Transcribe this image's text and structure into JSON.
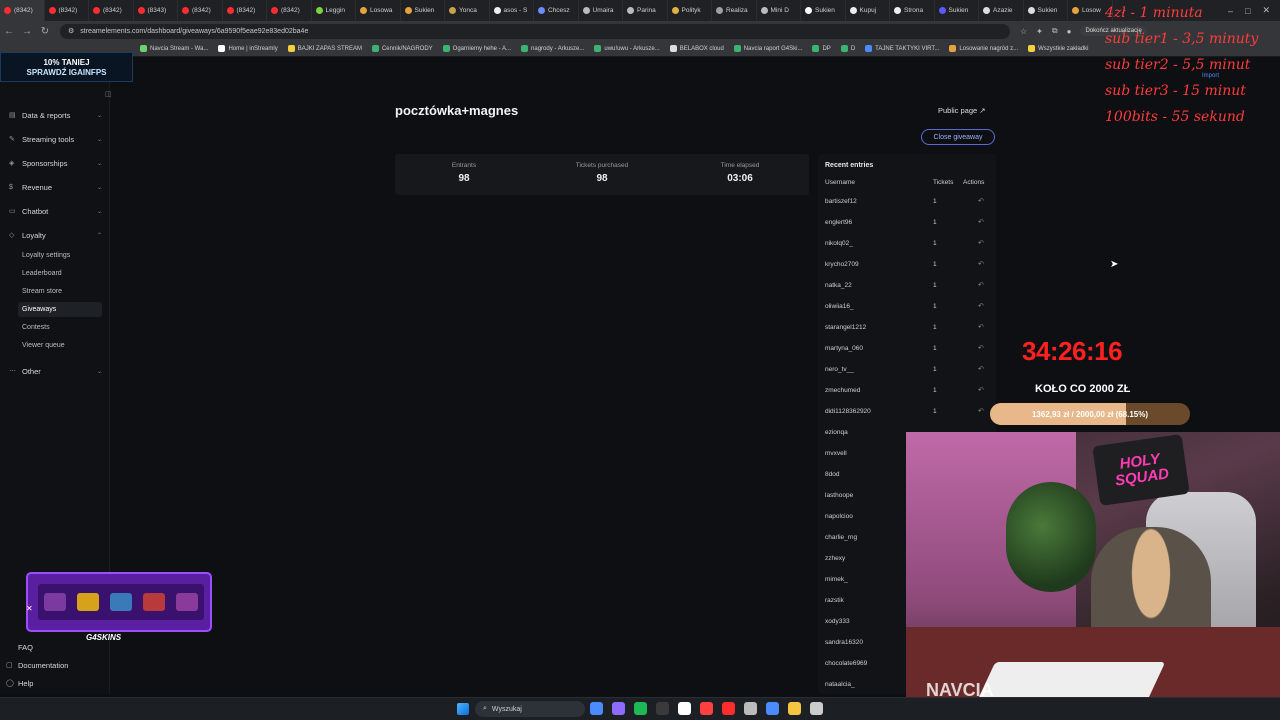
{
  "browser": {
    "tabs": [
      {
        "label": "(8342)",
        "color": "#ff2d2d"
      },
      {
        "label": "(8342)",
        "color": "#ff2d2d"
      },
      {
        "label": "(8342)",
        "color": "#ff2d2d"
      },
      {
        "label": "(8343)",
        "color": "#ff2d2d"
      },
      {
        "label": "(8342)",
        "color": "#ff2d2d"
      },
      {
        "label": "(8342)",
        "color": "#ff2d2d"
      },
      {
        "label": "(8342)",
        "color": "#ff2d2d"
      },
      {
        "label": "Leggin",
        "color": "#7cd142"
      },
      {
        "label": "Losowa",
        "color": "#e6a23c"
      },
      {
        "label": "Sukien",
        "color": "#e6a23c"
      },
      {
        "label": "Yonca",
        "color": "#c8a14b"
      },
      {
        "label": "asos - S",
        "color": "#eeeeee"
      },
      {
        "label": "Chcesz",
        "color": "#6b8cff"
      },
      {
        "label": "Umaira",
        "color": "#bbbbbb"
      },
      {
        "label": "Parina",
        "color": "#bbbbbb"
      },
      {
        "label": "Polityk",
        "color": "#e0b040"
      },
      {
        "label": "Realiza",
        "color": "#9aa0a6"
      },
      {
        "label": "Mini D",
        "color": "#bbbbbb"
      },
      {
        "label": "Sukien",
        "color": "#ffffff"
      },
      {
        "label": "Kupuj",
        "color": "#eeeeee"
      },
      {
        "label": "Strona",
        "color": "#eeeeee"
      },
      {
        "label": "Sukien",
        "color": "#5a5aff"
      },
      {
        "label": "Azazie",
        "color": "#dddddd"
      },
      {
        "label": "Sukien",
        "color": "#dddddd"
      },
      {
        "label": "Losow",
        "color": "#e6a23c"
      }
    ],
    "url": "streamelements.com/dashboard/giveaways/6a9590f5eae92e83ed02ba4e",
    "update_label": "Dokończ aktualizację",
    "bookmarks": [
      {
        "label": "Navcia Stream - Wa...",
        "color": "#6bd36b"
      },
      {
        "label": "Home | inStreamly",
        "color": "#ffffff"
      },
      {
        "label": "BAJKI ZAPAS STREAM",
        "color": "#f4d03f"
      },
      {
        "label": "Cennik/NAGRODY",
        "color": "#3cb371"
      },
      {
        "label": "Ogarniemy hehe - A...",
        "color": "#3cb371"
      },
      {
        "label": "nagrody - Arkusze...",
        "color": "#3cb371"
      },
      {
        "label": "uwu!uwu - Arkusze...",
        "color": "#3cb371"
      },
      {
        "label": "BELABOX cloud",
        "color": "#dddddd"
      },
      {
        "label": "Navcia raport G4Ski...",
        "color": "#3cb371"
      },
      {
        "label": "DP",
        "color": "#3cb371"
      },
      {
        "label": "D",
        "color": "#3cb371"
      },
      {
        "label": "TAJNE TAKTYKI VIRT...",
        "color": "#4a8cff"
      },
      {
        "label": "Losowanie nagród z...",
        "color": "#e6a23c"
      },
      {
        "label": "Wszystkie zakładki",
        "color": "#f4d03f"
      }
    ]
  },
  "promo": {
    "line1": "10% TANIEJ",
    "line2": "SPRAWDŹ IGAINFPS"
  },
  "sidebar": {
    "items": [
      {
        "label": "Data & reports",
        "chev": "⌄"
      },
      {
        "label": "Streaming tools",
        "chev": "⌄"
      },
      {
        "label": "Sponsorships",
        "chev": "⌄"
      },
      {
        "label": "Revenue",
        "chev": "⌄"
      },
      {
        "label": "Chatbot",
        "chev": "⌄"
      },
      {
        "label": "Loyalty",
        "chev": "⌃"
      }
    ],
    "loyalty_sub": [
      "Loyalty settings",
      "Leaderboard",
      "Stream store",
      "Giveaways",
      "Contests",
      "Viewer queue"
    ],
    "other": "Other",
    "footer": [
      "FAQ",
      "Documentation",
      "Help"
    ]
  },
  "giveaway": {
    "title": "pocztówka+magnes",
    "public_page": "Public page",
    "close_button": "Close giveaway",
    "stats": [
      {
        "label": "Entrants",
        "value": "98"
      },
      {
        "label": "Tickets purchased",
        "value": "98"
      },
      {
        "label": "Time elapsed",
        "value": "03:06"
      }
    ],
    "entries": {
      "title": "Recent entries",
      "col_username": "Username",
      "col_tickets": "Tickets",
      "col_actions": "Actions",
      "rows": [
        {
          "user": "bartiszef12",
          "tickets": "1"
        },
        {
          "user": "englert96",
          "tickets": "1"
        },
        {
          "user": "nikolq02_",
          "tickets": "1"
        },
        {
          "user": "krycho2709",
          "tickets": "1"
        },
        {
          "user": "natka_22",
          "tickets": "1"
        },
        {
          "user": "oliwiia16_",
          "tickets": "1"
        },
        {
          "user": "starangel1212",
          "tickets": "1"
        },
        {
          "user": "martyna_060",
          "tickets": "1"
        },
        {
          "user": "nero_tv__",
          "tickets": "1"
        },
        {
          "user": "zmechumed",
          "tickets": "1"
        },
        {
          "user": "didi1128362920",
          "tickets": "1"
        },
        {
          "user": "ezionqa",
          "tickets": ""
        },
        {
          "user": "mvxvell",
          "tickets": ""
        },
        {
          "user": "8dod",
          "tickets": ""
        },
        {
          "user": "lasthoope",
          "tickets": ""
        },
        {
          "user": "napolcioo",
          "tickets": ""
        },
        {
          "user": "charlie_rng",
          "tickets": ""
        },
        {
          "user": "zzhexy",
          "tickets": ""
        },
        {
          "user": "mimek_",
          "tickets": ""
        },
        {
          "user": "razstik",
          "tickets": ""
        },
        {
          "user": "xody333",
          "tickets": ""
        },
        {
          "user": "sandra16320",
          "tickets": ""
        },
        {
          "user": "chocolate6969",
          "tickets": ""
        },
        {
          "user": "nataalcia_",
          "tickets": ""
        }
      ]
    }
  },
  "stream": {
    "overlay_lines": [
      "4zł - 1 minuta",
      "sub tier1 - 3,5 minuty",
      "sub tier2 - 5,5 minut",
      "sub tier3 - 15 minut",
      "100bits - 55 sekund"
    ],
    "import_label": "Import",
    "timer": "34:26:16",
    "goal_title": "KOŁO CO 2000 ZŁ",
    "goal_text": "1362,93 zł / 2000,00 zł (68.15%)",
    "goal_fraction": 0.6815,
    "webcam_logo": "HOLY SQUAD",
    "webcam_name": "NAVCIA",
    "skins_logo": "G4SKINS"
  },
  "taskbar": {
    "search_placeholder": "Wyszukaj",
    "apps": [
      "#4a8cff",
      "#8e6bff",
      "#1db954",
      "#3a3a3a",
      "#ffffff",
      "#ff4040",
      "#ff2d2d",
      "#bbbbbb",
      "#4a8cff",
      "#f4c542",
      "#cccccc"
    ]
  }
}
